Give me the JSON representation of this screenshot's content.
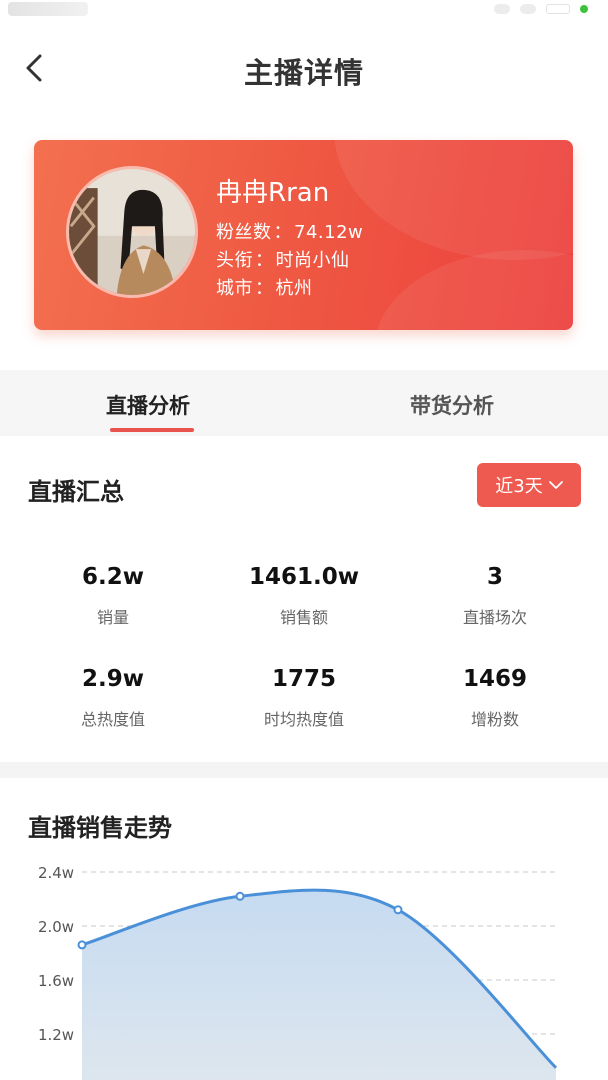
{
  "header": {
    "title": "主播详情"
  },
  "profile": {
    "name": "冉冉Rran",
    "fans_label": "粉丝数",
    "fans_value": "74.12w",
    "title_label": "头衔",
    "title_value": "时尚小仙",
    "city_label": "城市",
    "city_value": "杭州",
    "separator": "："
  },
  "tabs": [
    {
      "label": "直播分析",
      "active": true
    },
    {
      "label": "带货分析",
      "active": false
    }
  ],
  "summary": {
    "title": "直播汇总",
    "range_label": "近3天",
    "stats": [
      {
        "value": "6.2w",
        "label": "销量"
      },
      {
        "value": "1461.0w",
        "label": "销售额"
      },
      {
        "value": "3",
        "label": "直播场次"
      },
      {
        "value": "2.9w",
        "label": "总热度值"
      },
      {
        "value": "1775",
        "label": "时均热度值"
      },
      {
        "value": "1469",
        "label": "增粉数"
      }
    ]
  },
  "trend": {
    "title": "直播销售走势"
  },
  "colors": {
    "accent": "#ee5a4f",
    "line": "#4a90d9",
    "area": "#c9dcf0"
  },
  "chart_data": {
    "type": "area",
    "yticks": [
      "2.4w",
      "2.0w",
      "1.6w",
      "1.2w"
    ],
    "ylim": [
      1.0,
      2.4
    ],
    "points": [
      {
        "x": 0,
        "y": 1.86
      },
      {
        "x": 1,
        "y": 2.22
      },
      {
        "x": 2,
        "y": 2.12
      },
      {
        "x": 3,
        "y": 0.95
      }
    ],
    "grid": true
  }
}
